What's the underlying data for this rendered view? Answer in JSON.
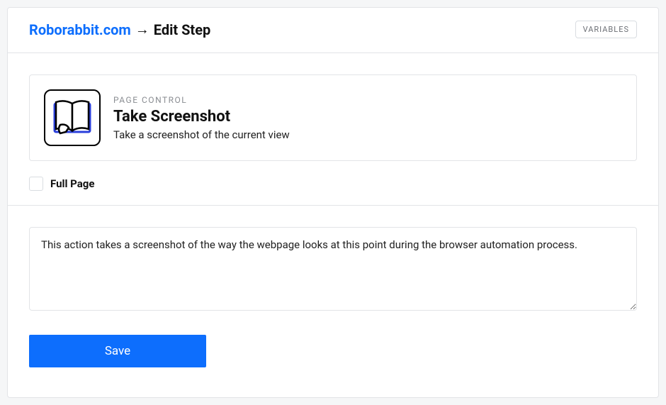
{
  "breadcrumb": {
    "link_label": "Roborabbit.com",
    "arrow": "→",
    "current": "Edit Step"
  },
  "variables_button_label": "VARIABLES",
  "card": {
    "category": "PAGE CONTROL",
    "title": "Take Screenshot",
    "description": "Take a screenshot of the current view"
  },
  "options": {
    "full_page": {
      "label": "Full Page",
      "checked": false
    }
  },
  "description_text": "This action takes a screenshot of the way the webpage looks at this point during the browser automation process.",
  "save_button_label": "Save"
}
